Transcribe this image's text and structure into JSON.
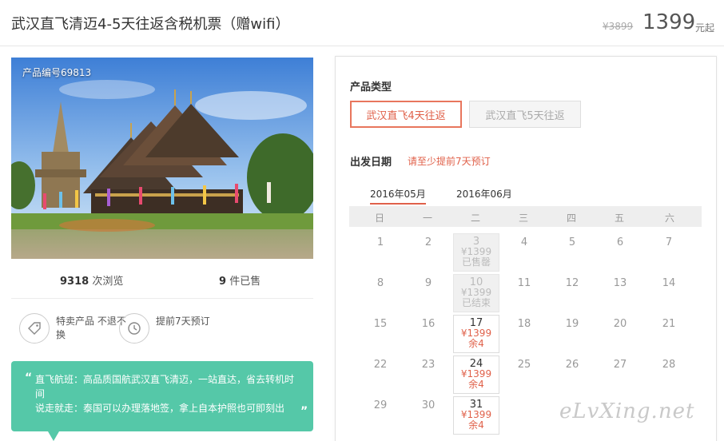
{
  "header": {
    "title": "武汉直飞清迈4-5天往返含税机票（赠wifi）",
    "price_original": "¥3899",
    "price_now": "1399",
    "price_unit": "元起"
  },
  "product": {
    "code_label": "产品编号69813",
    "views_count": "9318",
    "views_label": "次浏览",
    "sold_count": "9",
    "sold_label": "件已售"
  },
  "features": [
    {
      "icon": "tag-icon",
      "text": "特卖产品 不退不换"
    },
    {
      "icon": "clock-icon",
      "text": "提前7天预订"
    }
  ],
  "note": {
    "line1": "直飞航班：高品质国航武汉直飞清迈，一站直达，省去转机时间",
    "line2": "说走就走：泰国可以办理落地签，拿上自本护照也可即刻出"
  },
  "booking": {
    "type_label": "产品类型",
    "types": [
      {
        "label": "武汉直飞4天往返",
        "selected": true
      },
      {
        "label": "武汉直飞5天往返",
        "selected": false
      }
    ],
    "date_label": "出发日期",
    "date_hint": "请至少提前7天预订",
    "months": [
      "2016年05月",
      "2016年06月"
    ],
    "weekdays": [
      "日",
      "一",
      "二",
      "三",
      "四",
      "五",
      "六"
    ],
    "plain_days": [
      "1",
      "2",
      "4",
      "5",
      "6",
      "7",
      "8",
      "9",
      "11",
      "12",
      "13",
      "14",
      "15",
      "16",
      "18",
      "19",
      "20",
      "21",
      "22",
      "23",
      "25",
      "26",
      "27",
      "28",
      "29",
      "30"
    ],
    "special_days": [
      {
        "day": "3",
        "price": "¥1399",
        "status": "已售罄"
      },
      {
        "day": "10",
        "price": "¥1399",
        "status": "已结束"
      },
      {
        "day": "17",
        "price": "¥1399",
        "status": "余4"
      },
      {
        "day": "24",
        "price": "¥1399",
        "status": "余4"
      },
      {
        "day": "31",
        "price": "¥1399",
        "status": "余4"
      }
    ]
  },
  "watermark": "eLvXing.net"
}
